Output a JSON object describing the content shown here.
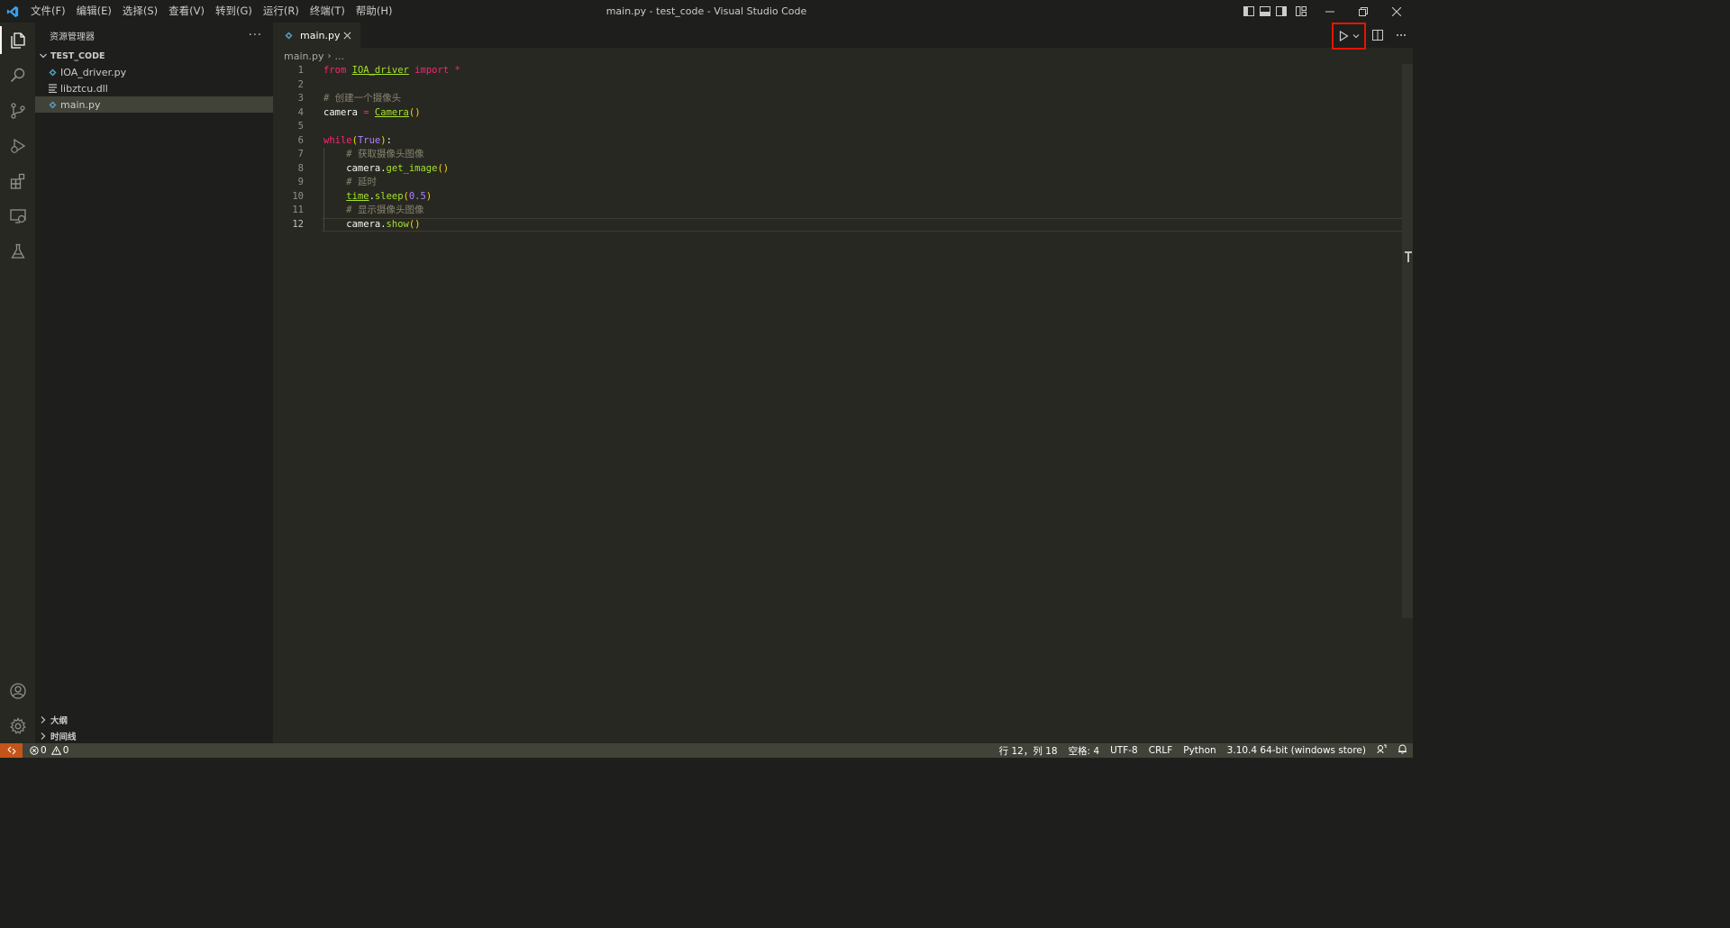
{
  "window": {
    "title": "main.py - test_code - Visual Studio Code"
  },
  "menu": [
    "文件(F)",
    "编辑(E)",
    "选择(S)",
    "查看(V)",
    "转到(G)",
    "运行(R)",
    "终端(T)",
    "帮助(H)"
  ],
  "sidebar": {
    "title": "资源管理器",
    "more": "···",
    "folder": "TEST_CODE",
    "files": [
      {
        "name": "IOA_driver.py",
        "icon": "python-file-icon",
        "selected": false
      },
      {
        "name": "libztcu.dll",
        "icon": "text-file-icon",
        "selected": false
      },
      {
        "name": "main.py",
        "icon": "python-file-icon",
        "selected": true
      }
    ],
    "sections": [
      "大纲",
      "时间线"
    ]
  },
  "tab": {
    "label": "main.py"
  },
  "breadcrumb": {
    "file": "main.py",
    "more": "..."
  },
  "code": {
    "current_line": 12,
    "lines": [
      {
        "n": "1",
        "t": "from IOA_driver import *"
      },
      {
        "n": "2",
        "t": ""
      },
      {
        "n": "3",
        "t": "# 创建一个摄像头"
      },
      {
        "n": "4",
        "t": "camera = Camera()"
      },
      {
        "n": "5",
        "t": ""
      },
      {
        "n": "6",
        "t": "while(True):"
      },
      {
        "n": "7",
        "t": "    # 获取摄像头图像"
      },
      {
        "n": "8",
        "t": "    camera.get_image()"
      },
      {
        "n": "9",
        "t": "    # 延时"
      },
      {
        "n": "10",
        "t": "    time.sleep(0.5)"
      },
      {
        "n": "11",
        "t": "    # 显示摄像头图像"
      },
      {
        "n": "12",
        "t": "    camera.show()"
      }
    ]
  },
  "status": {
    "errors": "0",
    "warnings": "0",
    "position": "行 12，列 18",
    "spaces": "空格: 4",
    "encoding": "UTF-8",
    "eol": "CRLF",
    "language": "Python",
    "interpreter": "3.10.4 64-bit (windows store)"
  },
  "colors": {
    "accent_highlight": "#e51400",
    "remote": "#c4541a",
    "statusbar": "#414339",
    "editor_bg": "#272822"
  }
}
